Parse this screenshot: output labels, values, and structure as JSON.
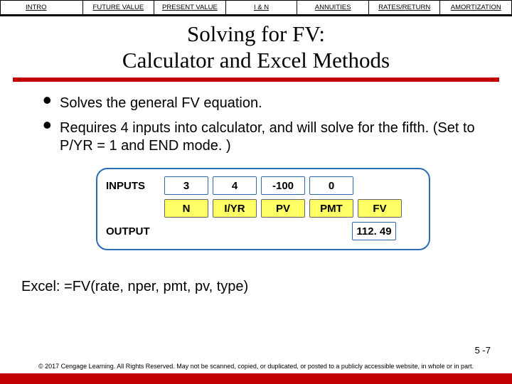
{
  "nav": {
    "items": [
      "INTRO",
      "FUTURE VALUE",
      "PRESENT VALUE",
      "I & N",
      "ANNUITIES",
      "RATES/RETURN",
      "AMORTIZATION"
    ]
  },
  "title_line1": "Solving for FV:",
  "title_line2": "Calculator and Excel Methods",
  "bullets": [
    "Solves the general FV equation.",
    "Requires 4 inputs into calculator, and will solve for the fifth. (Set to P/YR = 1 and END mode. )"
  ],
  "calc": {
    "inputs_label": "INPUTS",
    "output_label": "OUTPUT",
    "values": [
      "3",
      "4",
      "-100",
      "0"
    ],
    "output_value": "112. 49",
    "var_labels": [
      "N",
      "I/YR",
      "PV",
      "PMT",
      "FV"
    ]
  },
  "excel_line": "Excel:  =FV(rate, nper, pmt, pv, type)",
  "page_number": "5 -7",
  "copyright": "© 2017 Cengage Learning. All Rights Reserved. May not be scanned, copied, or duplicated, or posted to a publicly accessible website, in whole or in part."
}
